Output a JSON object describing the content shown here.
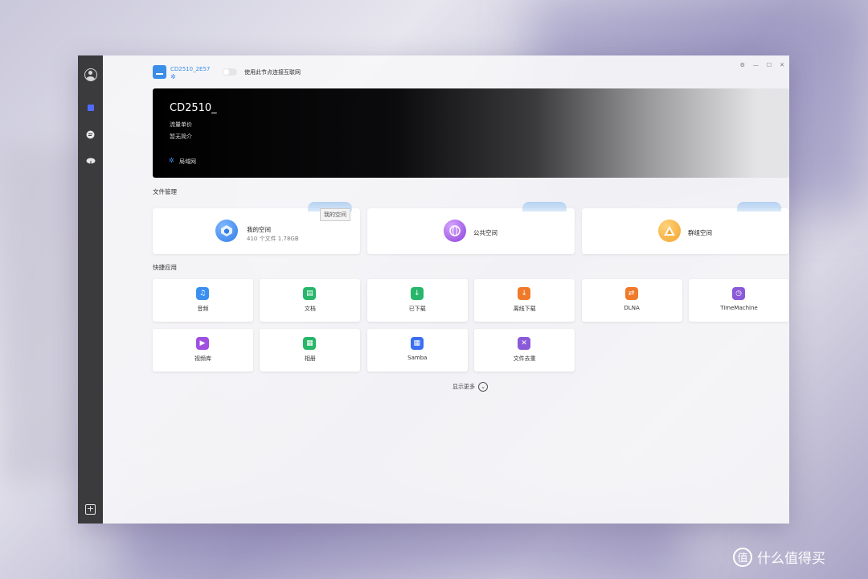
{
  "device": {
    "name": "CD2510_2E57",
    "net_icon": "network-icon"
  },
  "toggle": {
    "label": "使用此节点连接互联网",
    "on": false
  },
  "banner": {
    "title": "CD2510_",
    "line1": "流量单价",
    "line2": "暂无简介",
    "network": "局域网"
  },
  "file_section": {
    "title": "文件管理"
  },
  "file_cards": [
    {
      "label": "我的空间",
      "sub": "410 个文件 1.78GB",
      "tooltip": "我的空间",
      "icon": "cube-icon",
      "color": "#2f7de6"
    },
    {
      "label": "公共空间",
      "icon": "globe-icon",
      "color": "#8a3ed8"
    },
    {
      "label": "群组空间",
      "icon": "pyramid-icon",
      "color": "#f2a42c"
    }
  ],
  "apps_section": {
    "title": "快捷应用"
  },
  "apps": [
    {
      "label": "音频",
      "icon": "music-icon",
      "color": "#3b8ff0",
      "glyph": "♫"
    },
    {
      "label": "文档",
      "icon": "document-icon",
      "color": "#27b66a",
      "glyph": "▤"
    },
    {
      "label": "已下载",
      "icon": "downloaded-icon",
      "color": "#27b66a",
      "glyph": "↓"
    },
    {
      "label": "离线下载",
      "icon": "offline-download-icon",
      "color": "#f07a2a",
      "glyph": "↓"
    },
    {
      "label": "DLNA",
      "icon": "dlna-icon",
      "color": "#f07a2a",
      "glyph": "⇄"
    },
    {
      "label": "TimeMachine",
      "icon": "clock-icon",
      "color": "#8a5ad8",
      "glyph": "◷"
    },
    {
      "label": "视频库",
      "icon": "video-icon",
      "color": "#a050e0",
      "glyph": "▶"
    },
    {
      "label": "相册",
      "icon": "photo-icon",
      "color": "#27b66a",
      "glyph": "▦"
    },
    {
      "label": "Samba",
      "icon": "samba-icon",
      "color": "#3b6ff0",
      "glyph": "▦"
    },
    {
      "label": "文件去重",
      "icon": "dedupe-icon",
      "color": "#8a5ad8",
      "glyph": "✕"
    }
  ],
  "show_more": {
    "label": "显示更多"
  },
  "watermark": {
    "text": "什么值得买",
    "icon": "zhi-icon",
    "glyph": "值"
  }
}
